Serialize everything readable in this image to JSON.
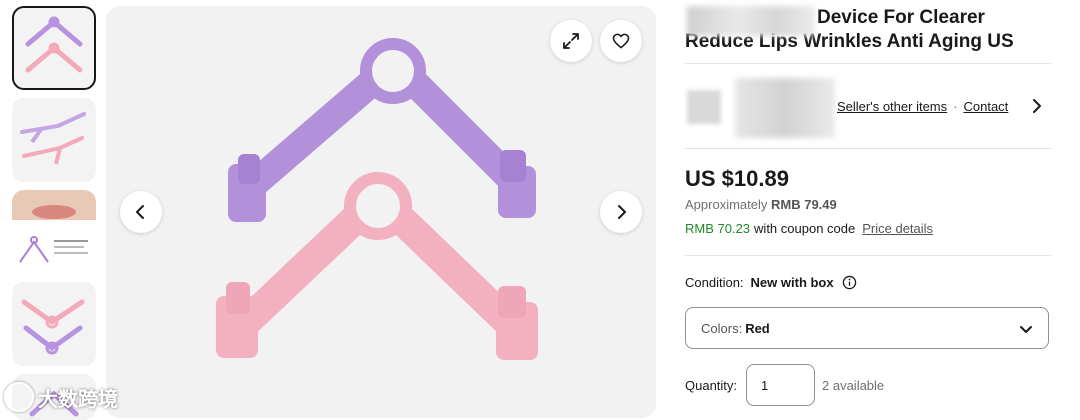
{
  "thumbnails": [
    {
      "name": "thumb-1-pink-purple-clips",
      "selected": true
    },
    {
      "name": "thumb-2-angled-clips",
      "selected": false
    },
    {
      "name": "thumb-3-lips-diagram",
      "selected": false
    },
    {
      "name": "thumb-4-stacked-clips",
      "selected": false
    },
    {
      "name": "thumb-5-partial",
      "selected": false
    }
  ],
  "gallery": {
    "expand_icon": "expand-icon",
    "favorite_icon": "heart-icon",
    "prev_icon": "chevron-left-icon",
    "next_icon": "chevron-right-icon",
    "product_colors": {
      "purple": "#a77fd6",
      "pink": "#f2a0b4"
    }
  },
  "watermark": {
    "text": "大数跨境"
  },
  "listing": {
    "title_line1": "Device For Clearer",
    "title_line2": "Reduce Lips Wrinkles Anti Aging US"
  },
  "seller": {
    "other_items_label": "Seller's other items",
    "separator": "·",
    "contact_label": "Contact"
  },
  "pricing": {
    "price": "US $10.89",
    "approx_label": "Approximately",
    "approx_value": "RMB 79.49",
    "coupon_price": "RMB 70.23",
    "coupon_text": "with coupon code",
    "price_details_link": "Price details",
    "coupon_color": "#1e8a2c"
  },
  "condition": {
    "label": "Condition:",
    "value": "New with box",
    "info_icon": "info-icon"
  },
  "variation": {
    "label": "Colors:",
    "selected": "Red"
  },
  "quantity": {
    "label": "Quantity:",
    "value": "1",
    "available": "2 available"
  }
}
